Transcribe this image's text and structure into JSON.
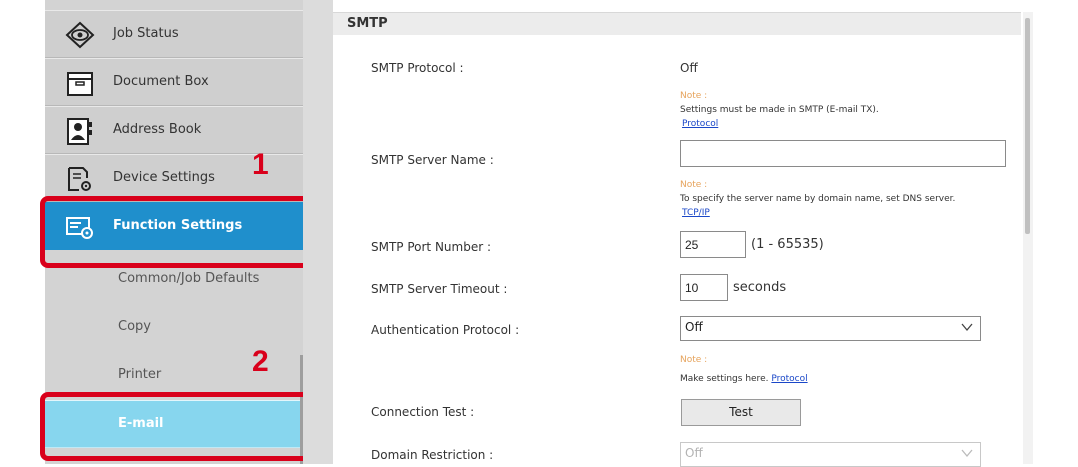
{
  "sidebar": {
    "items": [
      {
        "label": "Job Status",
        "icon": "eye-icon"
      },
      {
        "label": "Document Box",
        "icon": "folder-icon"
      },
      {
        "label": "Address Book",
        "icon": "address-book-icon"
      },
      {
        "label": "Device Settings",
        "icon": "device-settings-icon"
      },
      {
        "label": "Function Settings",
        "icon": "function-settings-icon"
      }
    ],
    "subitems": [
      {
        "label": "Common/Job Defaults"
      },
      {
        "label": "Copy"
      },
      {
        "label": "Printer"
      },
      {
        "label": "E-mail"
      }
    ]
  },
  "callouts": {
    "one": "1",
    "two": "2"
  },
  "smtp": {
    "header": "SMTP",
    "protocol_label": "SMTP Protocol :",
    "protocol_value": "Off",
    "note1_title": "Note :",
    "note1_text": "Settings must be made in SMTP (E-mail TX).",
    "note1_link": "Protocol",
    "server_name_label": "SMTP Server Name :",
    "server_name_value": "",
    "note2_title": "Note :",
    "note2_text": "To specify the server name by domain name, set DNS server.",
    "note2_link": "TCP/IP",
    "port_label": "SMTP Port Number :",
    "port_value": "25",
    "port_range": "(1 - 65535)",
    "timeout_label": "SMTP Server Timeout :",
    "timeout_value": "10",
    "timeout_unit": "seconds",
    "auth_label": "Authentication Protocol :",
    "auth_value": "Off",
    "note3_title": "Note :",
    "note3_text": "Make settings here.",
    "note3_link": "Protocol",
    "conn_test_label": "Connection Test :",
    "test_button": "Test",
    "domain_label": "Domain Restriction :",
    "domain_value": "Off"
  },
  "colors": {
    "accent": "#1f8fcc",
    "selected": "#87d6ee",
    "callout": "#d9001b",
    "note": "#e6a35c",
    "link": "#1a47c8"
  }
}
